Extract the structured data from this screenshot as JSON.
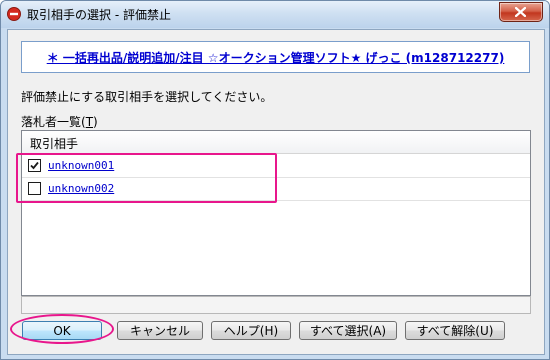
{
  "window": {
    "title": "取引相手の選択 - 評価禁止",
    "close_icon": "close-icon"
  },
  "auction": {
    "link_text": "＊ 一括再出品/説明追加/注目 ☆オークション管理ソフト★ げっこ (m128712277)"
  },
  "instruction_text": "評価禁止にする取引相手を選択してください。",
  "list": {
    "label_prefix": "落札者一覧(",
    "label_key": "T",
    "label_suffix": ")",
    "column_header": "取引相手",
    "rows": [
      {
        "name": "unknown001",
        "checked": true
      },
      {
        "name": "unknown002",
        "checked": false
      }
    ]
  },
  "buttons": {
    "ok": "OK",
    "cancel": "キャンセル",
    "help": "ヘルプ(H)",
    "select_all": "すべて選択(A)",
    "deselect_all": "すべて解除(U)"
  },
  "colors": {
    "annotation": "#e8168c",
    "link": "#0000cc"
  }
}
